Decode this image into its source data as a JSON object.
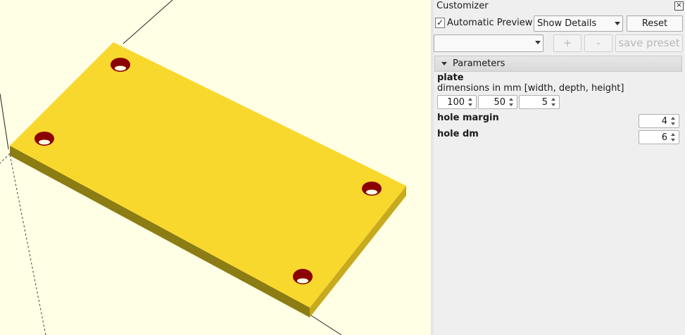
{
  "viewport": {
    "background": "#ffffe5",
    "model_color": "#f9d82e",
    "hole_color": "#8b0000"
  },
  "customizer": {
    "title": "Customizer",
    "close_icon": "close-icon",
    "automatic_preview": {
      "label": "Automatic Preview",
      "checked": true,
      "mark": "✓"
    },
    "details_combo": {
      "value": "Show Details"
    },
    "reset_label": "Reset",
    "preset_combo": {
      "value": ""
    },
    "add_preset_label": "+",
    "remove_preset_label": "-",
    "save_preset_label": "save preset",
    "section": {
      "label": "Parameters",
      "expanded": true
    },
    "params": {
      "plate": {
        "name": "plate",
        "description": "dimensions in mm [width, depth, height]",
        "values": [
          "100",
          "50",
          "5"
        ]
      },
      "hole_margin": {
        "name": "hole margin",
        "value": "4"
      },
      "hole_dm": {
        "name": "hole dm",
        "value": "6"
      }
    }
  }
}
